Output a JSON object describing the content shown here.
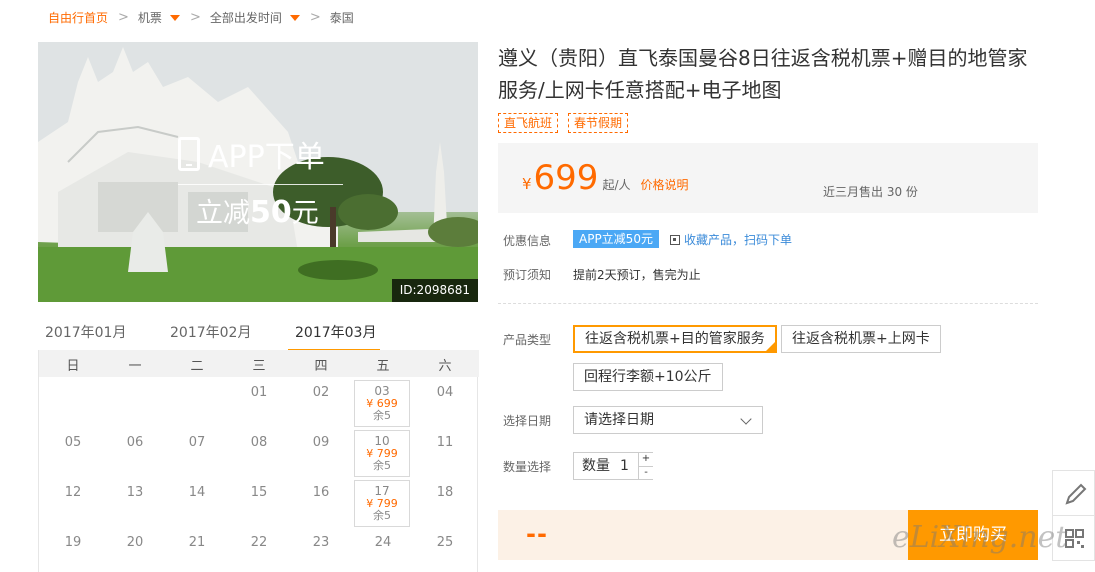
{
  "breadcrumb": {
    "home": "自由行首页",
    "items": [
      "机票",
      "全部出发时间",
      "泰国"
    ],
    "sep": ">"
  },
  "hero": {
    "promo_line1": "APP下单",
    "promo_line2_pre": "立减",
    "promo_line2_num": "50",
    "promo_line2_post": "元",
    "id_label": "ID:2098681"
  },
  "calendar": {
    "months": [
      "2017年01月",
      "2017年02月",
      "2017年03月"
    ],
    "active_month": "2017年03月",
    "weekdays": [
      "日",
      "一",
      "二",
      "三",
      "四",
      "五",
      "六"
    ],
    "rows": [
      [
        "",
        "",
        "",
        "01",
        "02",
        "03",
        "04"
      ],
      [
        "05",
        "06",
        "07",
        "08",
        "09",
        "10",
        "11"
      ],
      [
        "12",
        "13",
        "14",
        "15",
        "16",
        "17",
        "18"
      ],
      [
        "19",
        "20",
        "21",
        "22",
        "23",
        "24",
        "25"
      ]
    ],
    "available": [
      {
        "day": "03",
        "price": "¥ 699",
        "remain": "余5"
      },
      {
        "day": "10",
        "price": "¥ 799",
        "remain": "余5"
      },
      {
        "day": "17",
        "price": "¥ 799",
        "remain": "余5"
      }
    ]
  },
  "product": {
    "title": "遵义（贵阳）直飞泰国曼谷8日往返含税机票+赠目的地管家服务/上网卡任意搭配+电子地图",
    "tags": [
      "直飞航班",
      "春节假期"
    ],
    "currency": "¥",
    "price": "699",
    "price_unit": "起/人",
    "price_explain": "价格说明",
    "sold": "近三月售出 30 份"
  },
  "info": {
    "discount_label": "优惠信息",
    "discount_badge": "APP立减50元",
    "favorite": "收藏产品",
    "scan": "扫码下单",
    "booking_label": "预订须知",
    "booking_text": "提前2天预订，售完为止"
  },
  "options": {
    "type_label": "产品类型",
    "types": [
      "往返含税机票+目的管家服务",
      "往返含税机票+上网卡",
      "回程行李额+10公斤"
    ],
    "selected_type": "往返含税机票+目的管家服务",
    "date_label": "选择日期",
    "date_placeholder": "请选择日期",
    "qty_label": "数量选择",
    "qty_prefix": "数量",
    "qty_value": "1",
    "qty_plus": "+",
    "qty_minus": "-"
  },
  "buy": {
    "total": "--",
    "button": "立即购买"
  },
  "watermark": "eLiXing.net",
  "colors": {
    "accent": "#ff6a00",
    "button": "#ff9900",
    "link": "#3b8bd9",
    "badge": "#4ba8f5"
  }
}
